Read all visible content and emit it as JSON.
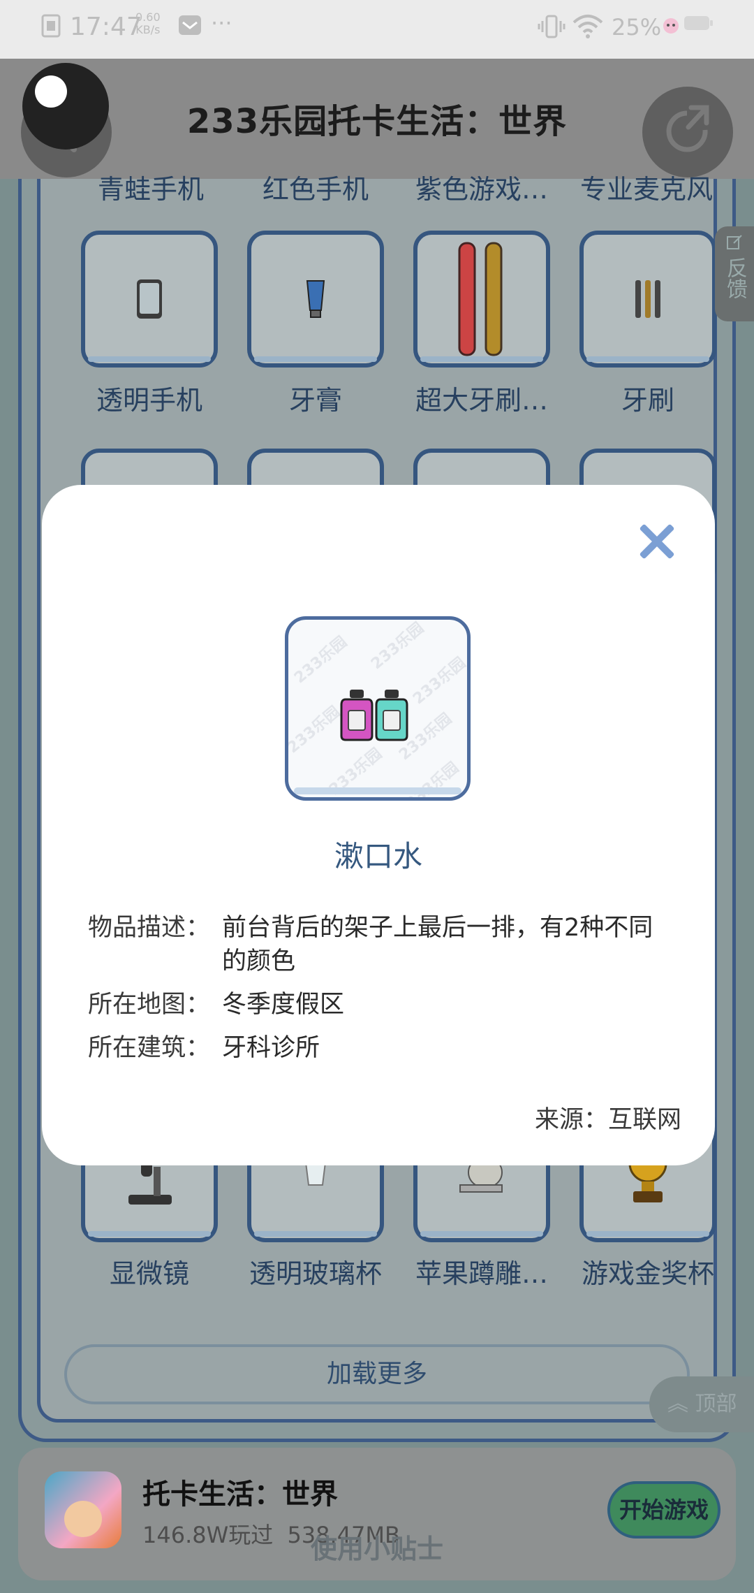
{
  "status_bar": {
    "time": "17:47",
    "net_speed": "0.60",
    "net_speed_unit": "KB/s",
    "more": "···",
    "battery": "25%"
  },
  "header": {
    "title": "233乐园托卡生活：世界"
  },
  "grid": {
    "row0_labels": [
      "青蛙手机",
      "红色手机",
      "紫色游戏…",
      "专业麦克风"
    ],
    "row1": [
      {
        "label": "透明手机",
        "icon": "phone-icon"
      },
      {
        "label": "牙膏",
        "icon": "toothpaste-icon"
      },
      {
        "label": "超大牙刷…",
        "icon": "big-toothbrush-icon"
      },
      {
        "label": "牙刷",
        "icon": "toothbrush-icon"
      }
    ],
    "row_last": [
      {
        "label": "显微镜",
        "icon": "microscope-icon"
      },
      {
        "label": "透明玻璃杯",
        "icon": "glass-icon"
      },
      {
        "label": "苹果蹲雕…",
        "icon": "statue-icon"
      },
      {
        "label": "游戏金奖杯",
        "icon": "trophy-icon"
      }
    ],
    "load_more": "加载更多"
  },
  "feedback": "反馈",
  "to_top": "顶部",
  "app": {
    "name": "托卡生活：世界",
    "plays": "146.8W玩过",
    "size": "538.47MB",
    "start_button": "开始游戏"
  },
  "tips": "使用小贴士",
  "modal": {
    "item_name": "漱口水",
    "watermark": "233乐园",
    "rows": [
      {
        "key": "物品描述：",
        "value": "前台背后的架子上最后一排，有2种不同的颜色"
      },
      {
        "key": "所在地图：",
        "value": "冬季度假区"
      },
      {
        "key": "所在建筑：",
        "value": "牙科诊所"
      }
    ],
    "source": "来源：互联网"
  },
  "colors": {
    "accent": "#35587f",
    "close": "#7b9fd4",
    "border": "#36567f"
  }
}
